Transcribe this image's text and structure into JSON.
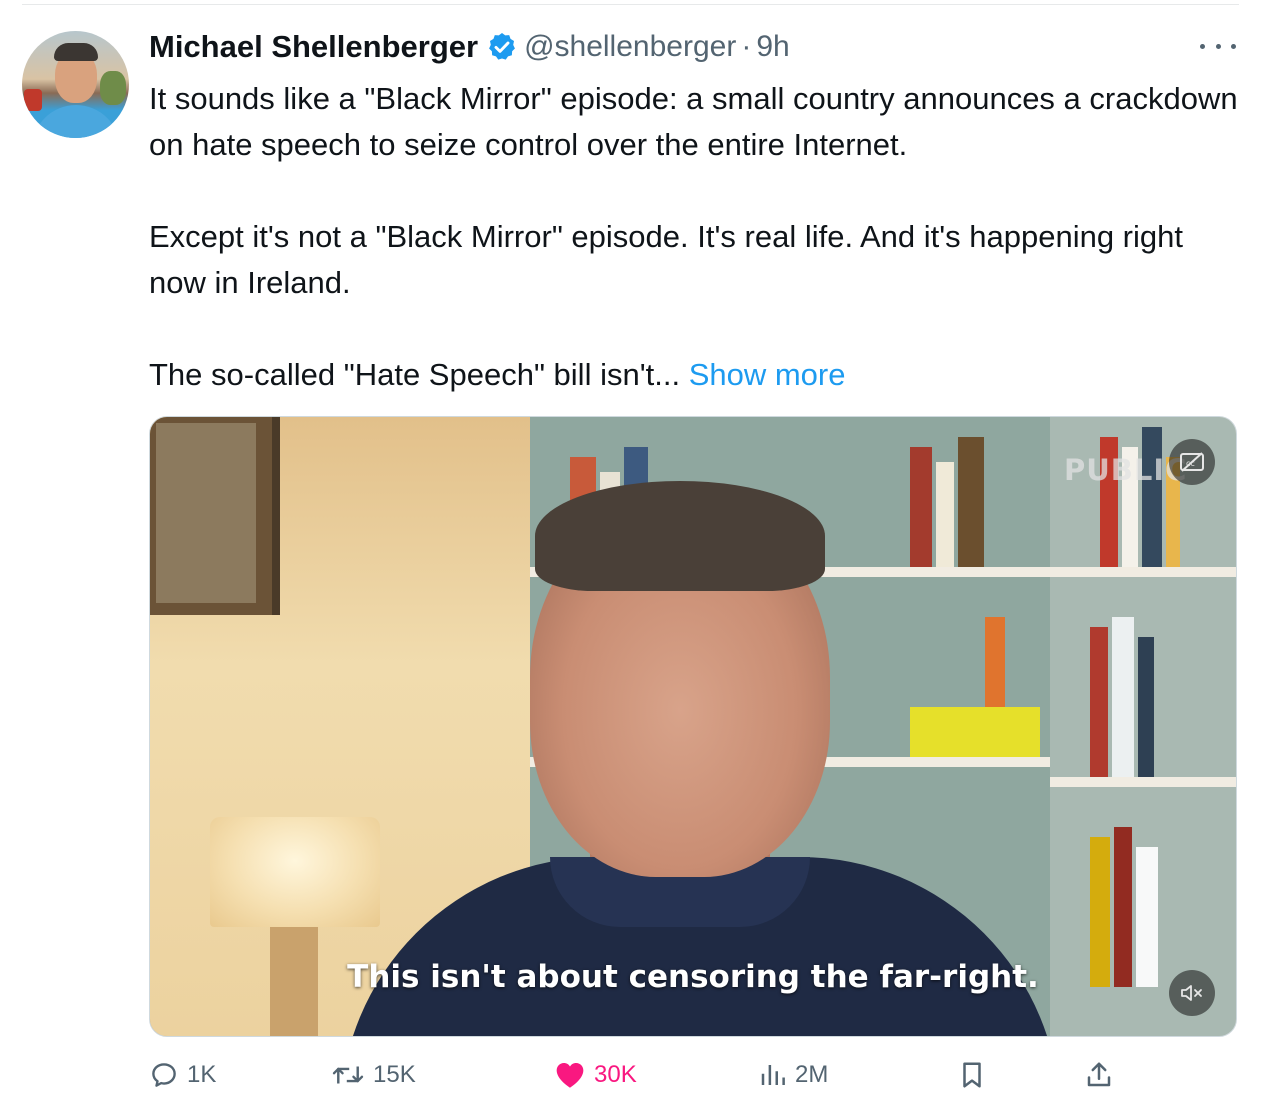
{
  "tweet": {
    "author_name": "Michael Shellenberger",
    "handle": "@shellenberger",
    "separator": "·",
    "time": "9h",
    "paragraph1": "It sounds like a \"Black Mirror\" episode: a small country announces a crackdown on hate speech to seize control over the entire Internet.",
    "paragraph2": "Except it's not a \"Black Mirror\" episode. It's real life. And it's happening right now in Ireland.",
    "paragraph3": "The so-called \"Hate Speech\" bill isn't...",
    "show_more": "Show more"
  },
  "video": {
    "watermark": "PUBLIC",
    "caption": "This isn't about censoring the far-right."
  },
  "actions": {
    "replies": "1K",
    "reposts": "15K",
    "likes": "30K",
    "views": "2M"
  },
  "colors": {
    "accent": "#1d9bf0",
    "like": "#f91880",
    "muted_text": "#536471"
  },
  "icons": [
    "verified-badge-icon",
    "more-options-icon",
    "closed-captions-icon",
    "mute-icon",
    "reply-icon",
    "repost-icon",
    "like-icon",
    "views-icon",
    "bookmark-icon",
    "share-icon"
  ]
}
